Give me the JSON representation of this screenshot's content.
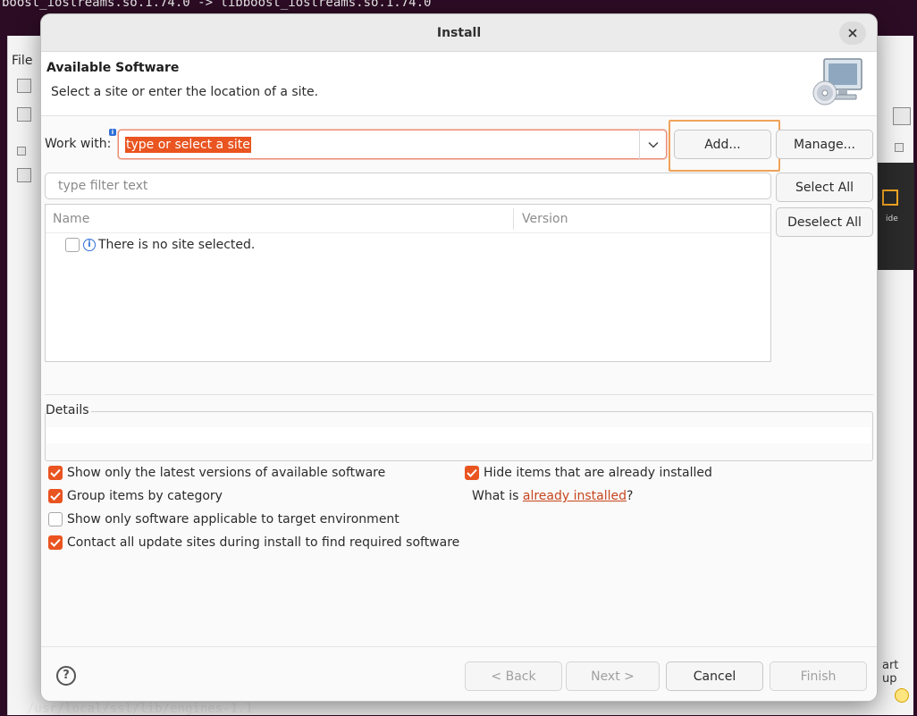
{
  "background": {
    "terminal_text": "boost_iostreams.so.1.74.0 -> libboost_iostreams.so.1.74.0",
    "terminal_bottom_text": "/usr/local/ssl/lib/engines-1.1",
    "menu_file": "File",
    "start_up": "art up",
    "ide_label": "ide"
  },
  "dialog": {
    "title": "Install",
    "header_title": "Available Software",
    "header_subtitle": "Select a site or enter the location of a site."
  },
  "work_with": {
    "label": "Work with:",
    "value": "type or select a site",
    "add_button": "Add...",
    "manage_button": "Manage..."
  },
  "filter": {
    "placeholder": "type filter text"
  },
  "select_all_button": "Select All",
  "deselect_all_button": "Deselect All",
  "table": {
    "columns": [
      "Name",
      "Version"
    ],
    "rows": [
      {
        "text": "There is no site selected.",
        "checked": false
      }
    ]
  },
  "details": {
    "label": "Details"
  },
  "options": {
    "latest_versions": {
      "label": "Show only the latest versions of available software",
      "checked": true
    },
    "group_by_category": {
      "label": "Group items by category",
      "checked": true
    },
    "target_env": {
      "label": "Show only software applicable to target environment",
      "checked": false
    },
    "contact_sites": {
      "label": "Contact all update sites during install to find required software",
      "checked": true
    },
    "hide_installed": {
      "label": "Hide items that are already installed",
      "checked": true
    }
  },
  "what_is": {
    "prefix": "What is ",
    "link": "already installed",
    "suffix": "?"
  },
  "footer": {
    "back": "< Back",
    "next": "Next >",
    "cancel": "Cancel",
    "finish": "Finish"
  },
  "colors": {
    "accent": "#e95420",
    "highlight": "#f0a25a",
    "link": "#c7451c"
  },
  "icons": [
    "close-icon",
    "monitor-cd-icon",
    "chevron-down-icon",
    "info-icon",
    "help-icon",
    "check-icon"
  ]
}
